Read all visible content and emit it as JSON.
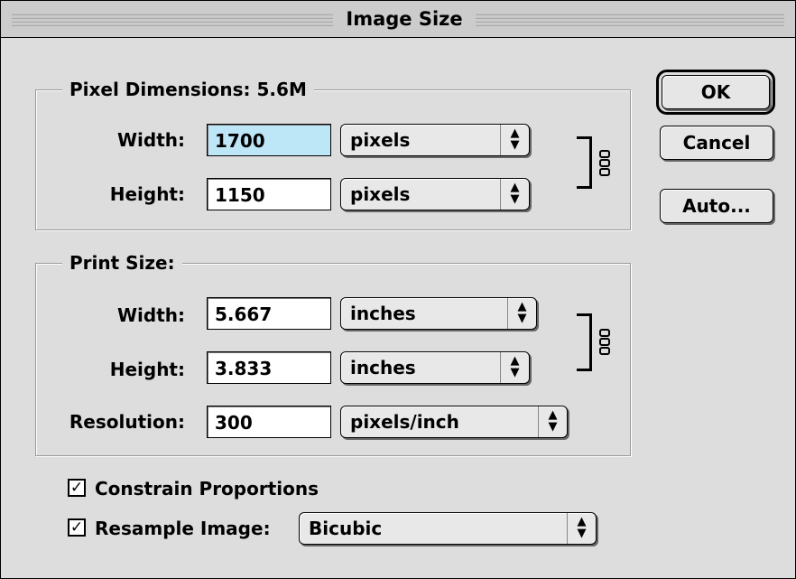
{
  "window": {
    "title": "Image Size"
  },
  "pixel_dimensions": {
    "label": "Pixel Dimensions:",
    "size_value": "5.6M",
    "width": {
      "label": "Width:",
      "value": "1700",
      "unit": "pixels"
    },
    "height": {
      "label": "Height:",
      "value": "1150",
      "unit": "pixels"
    }
  },
  "print_size": {
    "label": "Print Size:",
    "width": {
      "label": "Width:",
      "value": "5.667",
      "unit": "inches"
    },
    "height": {
      "label": "Height:",
      "value": "3.833",
      "unit": "inches"
    },
    "resolution": {
      "label": "Resolution:",
      "value": "300",
      "unit": "pixels/inch"
    }
  },
  "buttons": {
    "ok": "OK",
    "cancel": "Cancel",
    "auto": "Auto..."
  },
  "options": {
    "constrain": {
      "label": "Constrain Proportions",
      "checked": true
    },
    "resample": {
      "label": "Resample Image:",
      "checked": true,
      "method": "Bicubic"
    }
  },
  "icons": {
    "popup_arrows": "up-down-arrows-icon",
    "link": "chain-link-icon",
    "checkmark": "checkmark-icon"
  }
}
